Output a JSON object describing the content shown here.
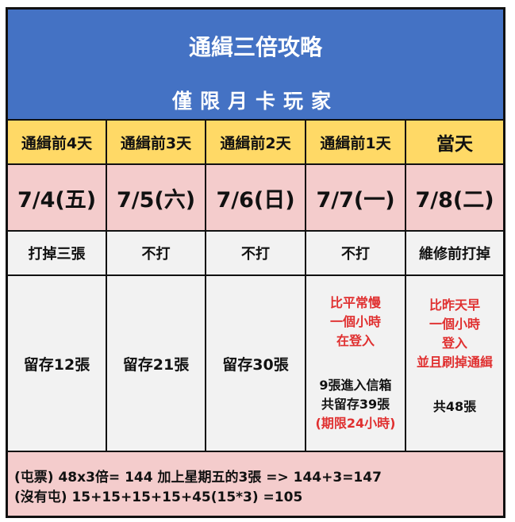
{
  "title": "通緝三倍攻略",
  "subtitle": "僅限月卡玩家",
  "columns": [
    {
      "head": "通緝前4天",
      "date": "7/4(五)",
      "action": "打掉三張"
    },
    {
      "head": "通緝前3天",
      "date": "7/5(六)",
      "action": "不打"
    },
    {
      "head": "通緝前2天",
      "date": "7/6(日)",
      "action": "不打"
    },
    {
      "head": "通緝前1天",
      "date": "7/7(一)",
      "action": "不打"
    },
    {
      "head": "當天",
      "date": "7/8(二)",
      "action": "維修前打掉"
    }
  ],
  "details": {
    "c0": "留存12張",
    "c1": "留存21張",
    "c2": "留存30張",
    "c3": {
      "red_lines": [
        "比平常慢",
        "一個小時",
        "在登入"
      ],
      "dark_lines": [
        "9張進入信箱",
        "共留存39張"
      ],
      "red_note": "(期限24小時)"
    },
    "c4": {
      "red_lines": [
        "比昨天早",
        "一個小時",
        "登入",
        "並且刷掉通緝"
      ],
      "dark_line": "共48張"
    }
  },
  "footer": {
    "line1": "(屯票) 48x3倍= 144 加上星期五的3張 => 144+3=147",
    "line2": "(沒有屯) 15+15+15+15+45(15*3) =105"
  },
  "colors": {
    "header_bg": "#4472c4",
    "head_row_bg": "#ffd966",
    "date_row_bg": "#f4cccc",
    "body_bg": "#f2f2f2",
    "accent_red": "#e03030"
  }
}
